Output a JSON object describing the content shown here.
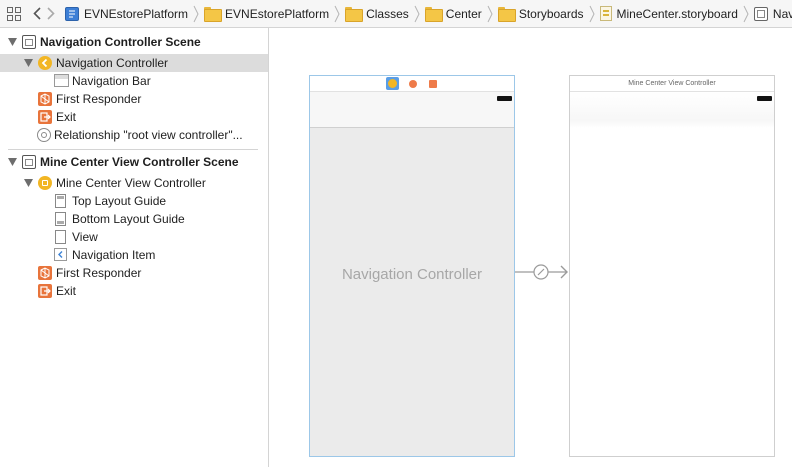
{
  "jumpbar": {
    "crumbs": [
      {
        "label": "EVNEstorePlatform",
        "icon": "xcode-project-icon"
      },
      {
        "label": "EVNEstorePlatform",
        "icon": "folder-icon"
      },
      {
        "label": "Classes",
        "icon": "folder-icon"
      },
      {
        "label": "Center",
        "icon": "folder-icon"
      },
      {
        "label": "Storyboards",
        "icon": "folder-icon"
      },
      {
        "label": "MineCenter.storyboard",
        "icon": "storyboard-file-icon"
      },
      {
        "label": "Navigati",
        "icon": "scene-icon"
      }
    ]
  },
  "outline": {
    "scene1": {
      "title": "Navigation Controller Scene",
      "items": [
        "Navigation Controller",
        "Navigation Bar",
        "First Responder",
        "Exit",
        "Relationship \"root view controller\"..."
      ]
    },
    "scene2": {
      "title": "Mine Center View Controller Scene",
      "items": [
        "Mine Center View Controller",
        "Top Layout Guide",
        "Bottom Layout Guide",
        "View",
        "Navigation Item",
        "First Responder",
        "Exit"
      ]
    }
  },
  "canvas": {
    "nav_controller_title": "Navigation Controller",
    "mine_vc_title": "Mine Center View Controller"
  },
  "colors": {
    "accent_yellow": "#f2b624",
    "responder_orange": "#e8743b",
    "selection_border": "#9cc7e8"
  }
}
